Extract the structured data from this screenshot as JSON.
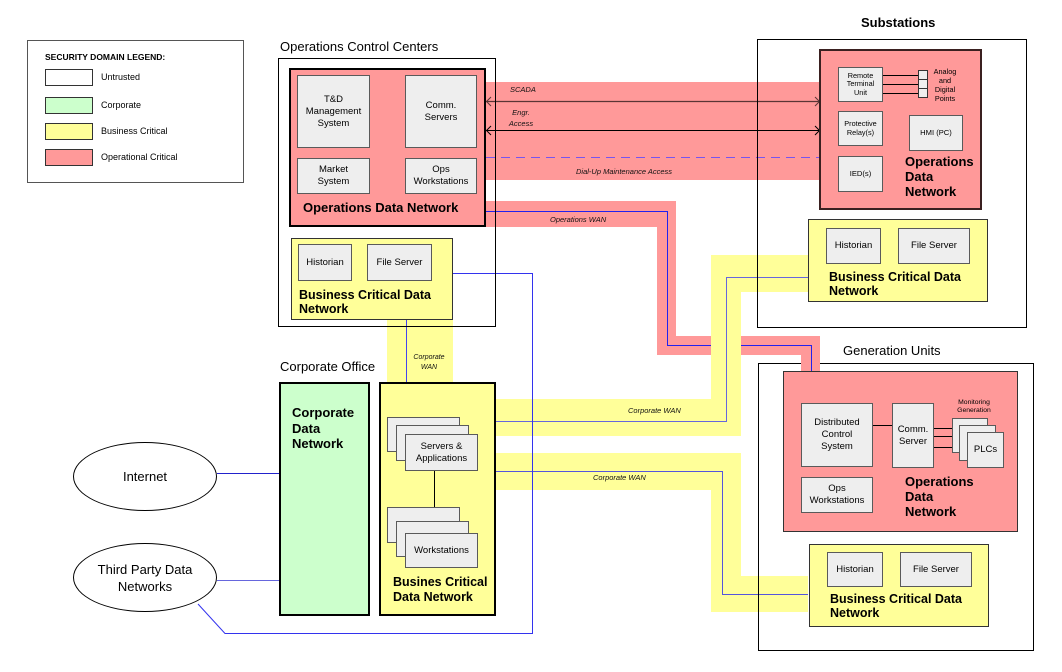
{
  "legend": {
    "title": "SECURITY DOMAIN LEGEND:",
    "items": [
      {
        "label": "Untrusted",
        "color": "#FFFFFF"
      },
      {
        "label": "Corporate",
        "color": "#CCFFCC"
      },
      {
        "label": "Business Critical",
        "color": "#FFFF99"
      },
      {
        "label": "Operational Critical",
        "color": "#FF9999"
      }
    ]
  },
  "operations_control_centers": {
    "title": "Operations Control Centers",
    "operations_network": {
      "label": "Operations Data Network",
      "nodes": {
        "td_management": "T&D\nManagement\nSystem",
        "comm_servers": "Comm.\nServers",
        "market_system": "Market\nSystem",
        "ops_workstations": "Ops\nWorkstations"
      }
    },
    "business_network": {
      "label": "Business Critical Data\nNetwork",
      "nodes": {
        "historian": "Historian",
        "file_server": "File Server"
      }
    }
  },
  "substations": {
    "title": "Substations",
    "operations_network": {
      "label": "Operations\nData\nNetwork",
      "nodes": {
        "rtu": "Remote\nTerminal\nUnit",
        "protective_relays": "Protective\nRelay(s)",
        "ieds": "IED(s)",
        "hmi": "HMI (PC)",
        "io_points": "Analog\nand\nDigital\nPoints"
      }
    },
    "business_network": {
      "label": "Business Critical Data\nNetwork",
      "nodes": {
        "historian": "Historian",
        "file_server": "File Server"
      }
    }
  },
  "generation_units": {
    "title": "Generation Units",
    "operations_network": {
      "label": "Operations\nData\nNetwork",
      "nodes": {
        "dcs": "Distributed\nControl\nSystem",
        "comm_server": "Comm.\nServer",
        "monitoring_label": "Monitoring\nGeneration",
        "plcs": "PLCs",
        "ops_workstations": "Ops\nWorkstations"
      }
    },
    "business_network": {
      "label": "Business Critical Data\nNetwork",
      "nodes": {
        "historian": "Historian",
        "file_server": "File Server"
      }
    }
  },
  "corporate_office": {
    "title": "Corporate Office",
    "corporate_network": {
      "label": "Corporate\nData\nNetwork"
    },
    "business_network": {
      "label": "Busines Critical\nData Network",
      "nodes": {
        "servers_applications": "Servers &\nApplications",
        "workstations": "Workstations"
      }
    }
  },
  "external_networks": [
    {
      "label": "Internet"
    },
    {
      "label": "Third Party Data\nNetworks"
    }
  ],
  "links": {
    "scada": "SCADA",
    "engr_access": "Engr.\nAccess",
    "dialup": "Dial-Up Maintenance Access",
    "operations_wan": "Operations WAN",
    "corporate_wan_ops": "Corporate\nWAN",
    "corporate_wan_substations": "Corporate WAN",
    "corporate_wan_generation": "Corporate WAN"
  }
}
